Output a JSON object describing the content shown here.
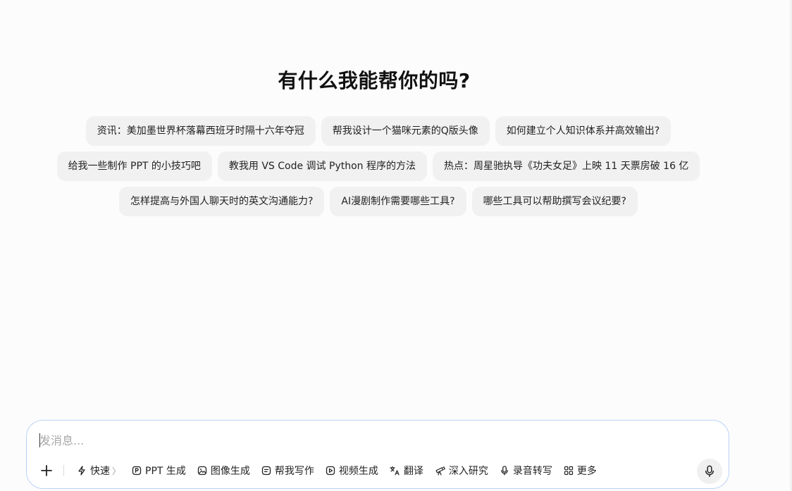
{
  "heading": "有什么我能帮你的吗?",
  "suggestions": {
    "row1": [
      "资讯：美加墨世界杯落幕西班牙时隔十六年夺冠",
      "帮我设计一个猫咪元素的Q版头像",
      "如何建立个人知识体系并高效输出?"
    ],
    "row2": [
      "给我一些制作 PPT 的小技巧吧",
      "教我用 VS Code 调试 Python 程序的方法",
      "热点：周星驰执导《功夫女足》上映 11 天票房破 16 亿"
    ],
    "row3": [
      "怎样提高与外国人聊天时的英文沟通能力?",
      "AI漫剧制作需要哪些工具?",
      "哪些工具可以帮助撰写会议纪要?"
    ]
  },
  "composer": {
    "placeholder": "发消息...",
    "value": "",
    "tools": [
      {
        "label": "快速",
        "icon": "lightning-icon",
        "has_arrow": true
      },
      {
        "label": "PPT 生成",
        "icon": "ppt-icon"
      },
      {
        "label": "图像生成",
        "icon": "image-icon"
      },
      {
        "label": "帮我写作",
        "icon": "writing-icon"
      },
      {
        "label": "视频生成",
        "icon": "video-icon"
      },
      {
        "label": "翻译",
        "icon": "translate-icon"
      },
      {
        "label": "深入研究",
        "icon": "telescope-icon"
      },
      {
        "label": "录音转写",
        "icon": "microphone-icon"
      },
      {
        "label": "更多",
        "icon": "grid-icon"
      }
    ],
    "arrow_glyph": "〉"
  },
  "colors": {
    "background": "#fcfcfc",
    "chip": "#f1f1f1",
    "composer_border": "#b9d3f7",
    "text": "#1f1f1f"
  }
}
